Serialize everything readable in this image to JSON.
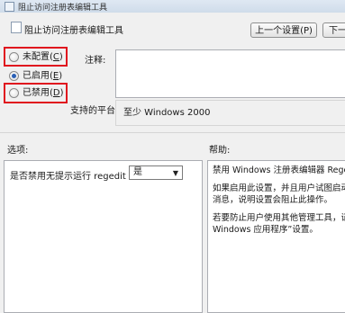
{
  "window": {
    "title": "阻止访问注册表编辑工具"
  },
  "header": {
    "title": "阻止访问注册表编辑工具"
  },
  "nav": {
    "prev_label": "上一个设置(P)",
    "next_label": "下一"
  },
  "state": {
    "not_configured": {
      "label": "未配置",
      "mnemonic": "C"
    },
    "enabled": {
      "label": "已启用",
      "mnemonic": "E"
    },
    "disabled": {
      "label": "已禁用",
      "mnemonic": "D"
    },
    "selected": "enabled"
  },
  "comment": {
    "label": "注释:",
    "value": ""
  },
  "platform": {
    "label": "支持的平台:",
    "value": "至少 Windows 2000"
  },
  "options": {
    "heading": "选项:",
    "prompt": "是否禁用无提示运行 regedit ?",
    "select_value": "是"
  },
  "help": {
    "heading": "帮助:",
    "lines": [
      "禁用 Windows 注册表编辑器 Regedit",
      "如果启用此设置，并且用户试图启动注",
      "消息，说明设置会阻止此操作。",
      "若要防止用户使用其他管理工具，请使",
      "Windows 应用程序”设置。"
    ]
  },
  "colors": {
    "highlight": "#e0141e",
    "radio_dot": "#2a5fb5"
  }
}
